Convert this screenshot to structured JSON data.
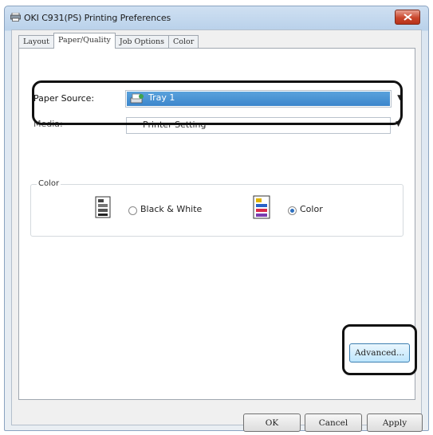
{
  "window": {
    "title": "OKI C931(PS) Printing Preferences"
  },
  "tabs": [
    {
      "label": "Layout"
    },
    {
      "label": "Paper/Quality"
    },
    {
      "label": "Job Options"
    },
    {
      "label": "Color"
    }
  ],
  "active_tab": "Paper/Quality",
  "paper": {
    "source_label": "Paper Source:",
    "source_value": "Tray 1",
    "media_label": "Media:",
    "media_value": "Printer Setting"
  },
  "color_group": {
    "label": "Color",
    "options": [
      {
        "label": "Black & White",
        "selected": false
      },
      {
        "label": "Color",
        "selected": true
      }
    ]
  },
  "buttons": {
    "advanced": "Advanced...",
    "ok": "OK",
    "cancel": "Cancel",
    "apply": "Apply"
  },
  "colors": {
    "selection": "#3c86cc",
    "close_button": "#c9462c"
  }
}
